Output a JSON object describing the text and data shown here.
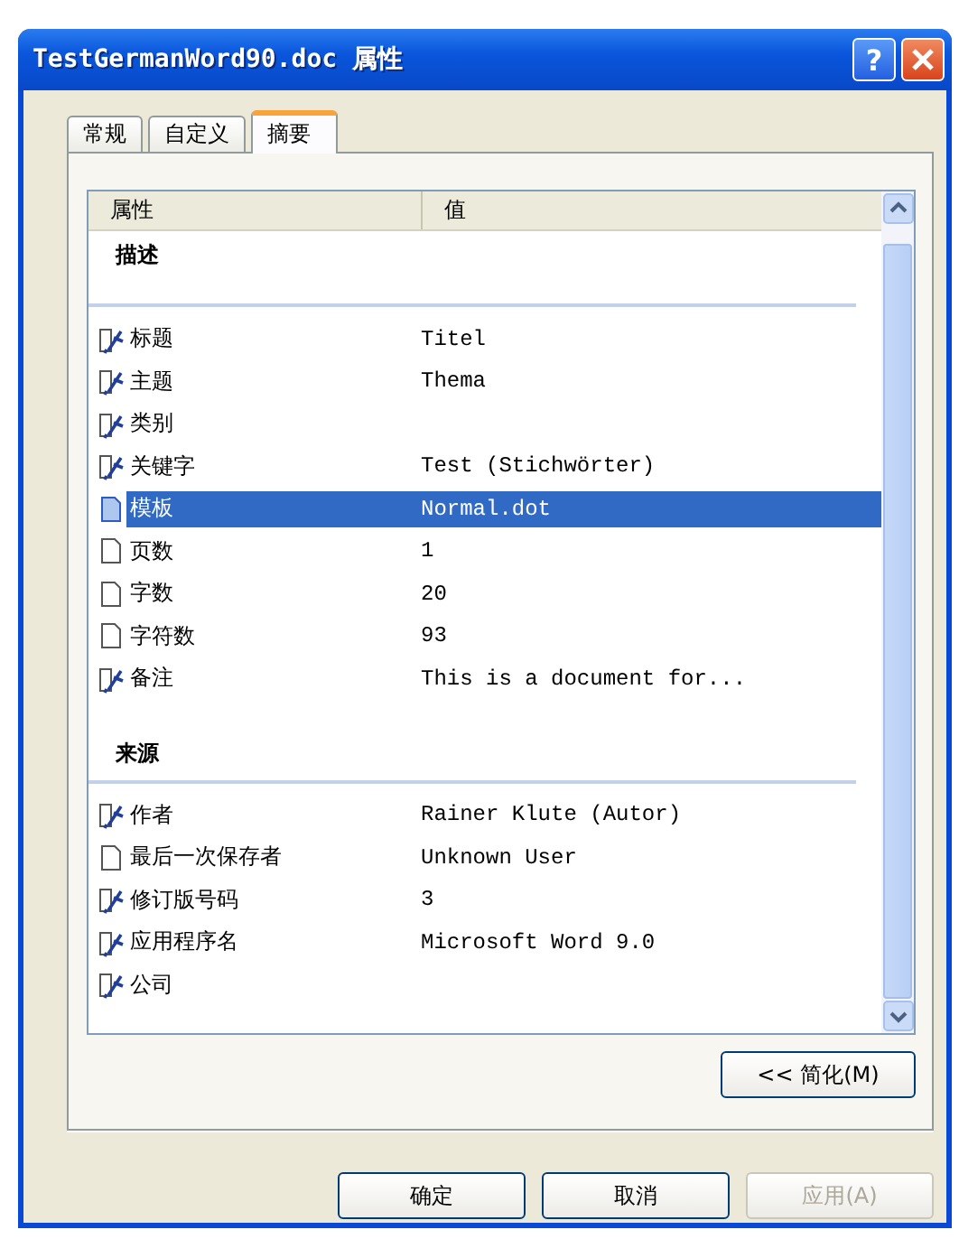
{
  "window": {
    "title": "TestGermanWord90.doc 属性",
    "help_label": "?"
  },
  "tabs": [
    {
      "label": "常规",
      "selected": false
    },
    {
      "label": "自定义",
      "selected": false
    },
    {
      "label": "摘要",
      "selected": true
    }
  ],
  "list": {
    "columns": [
      "属性",
      "值"
    ],
    "sections": [
      {
        "title": "描述",
        "rows": [
          {
            "name": "标题",
            "value": "Titel",
            "kind": "editable",
            "selected": false
          },
          {
            "name": "主题",
            "value": "Thema",
            "kind": "editable",
            "selected": false
          },
          {
            "name": "类别",
            "kind": "editable",
            "selected": false
          },
          {
            "name": "关键字",
            "value": "Test (Stichwörter)",
            "kind": "editable",
            "selected": false
          },
          {
            "name": "模板",
            "value": "Normal.dot",
            "kind": "readonly",
            "selected": true
          },
          {
            "name": "页数",
            "value": "1",
            "kind": "readonly",
            "selected": false
          },
          {
            "name": "字数",
            "value": "20",
            "kind": "readonly",
            "selected": false
          },
          {
            "name": "字符数",
            "value": "93",
            "kind": "readonly",
            "selected": false
          },
          {
            "name": "备注",
            "value": "This is a document for...",
            "kind": "editable",
            "selected": false
          }
        ]
      },
      {
        "title": "来源",
        "rows": [
          {
            "name": "作者",
            "value": "Rainer Klute (Autor)",
            "kind": "editable",
            "selected": false
          },
          {
            "name": "最后一次保存者",
            "value": "Unknown User",
            "kind": "readonly",
            "selected": false
          },
          {
            "name": "修订版号码",
            "value": "3",
            "kind": "editable",
            "selected": false
          },
          {
            "name": "应用程序名",
            "value": "Microsoft Word 9.0",
            "kind": "editable",
            "selected": false
          },
          {
            "name": "公司",
            "kind": "editable",
            "selected": false
          }
        ]
      }
    ]
  },
  "toggle_button": "<< 简化(M)",
  "buttons": [
    {
      "label": "确定",
      "disabled": false
    },
    {
      "label": "取消",
      "disabled": false
    },
    {
      "label": "应用(A)",
      "disabled": true
    }
  ]
}
